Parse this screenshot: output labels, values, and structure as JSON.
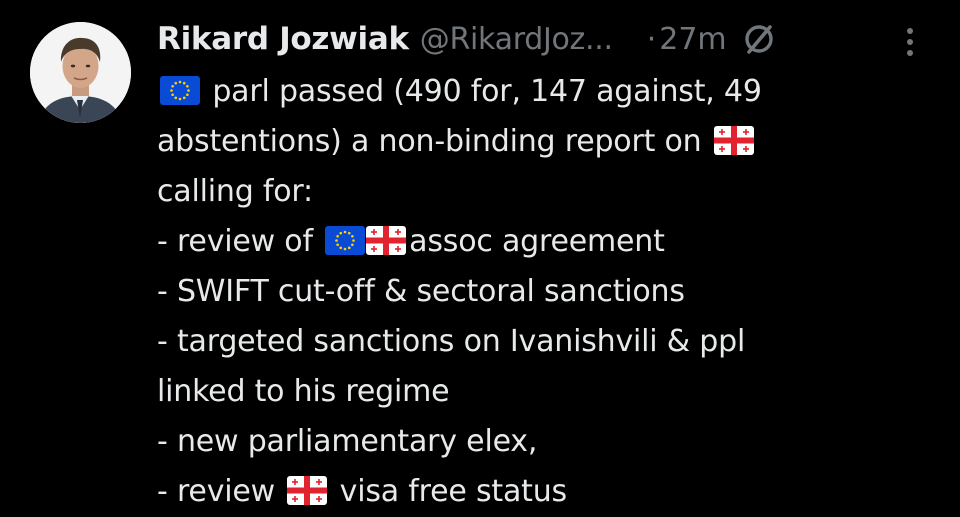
{
  "author": {
    "name": "Rikard Jozwiak",
    "handle": "@RikardJoz...",
    "separator": "·",
    "time": "27m"
  },
  "icons": {
    "avatar": "profile-photo",
    "grok": "grok-icon",
    "more": "more-vertical-icon",
    "eu_flag": "eu-flag-icon",
    "georgia_flag": "georgia-flag-icon"
  },
  "colors": {
    "background": "#000000",
    "text": "#e7e9ea",
    "secondary": "#71767b"
  },
  "tweet": {
    "line1_text": " parl passed (490 for, 147 against, 49",
    "line2_text": "abstentions) a non-binding report on ",
    "line3_text": "calling for:",
    "line4_prefix": "- review of ",
    "line4_suffix": "assoc agreement",
    "line5_text": "- SWIFT cut-off & sectoral sanctions",
    "line6_text": "- targeted sanctions on Ivanishvili & ppl",
    "line7_text": "linked to his regime",
    "line8_text": "- new parliamentary elex,",
    "line9_prefix": "- review ",
    "line9_suffix": " visa free status"
  }
}
